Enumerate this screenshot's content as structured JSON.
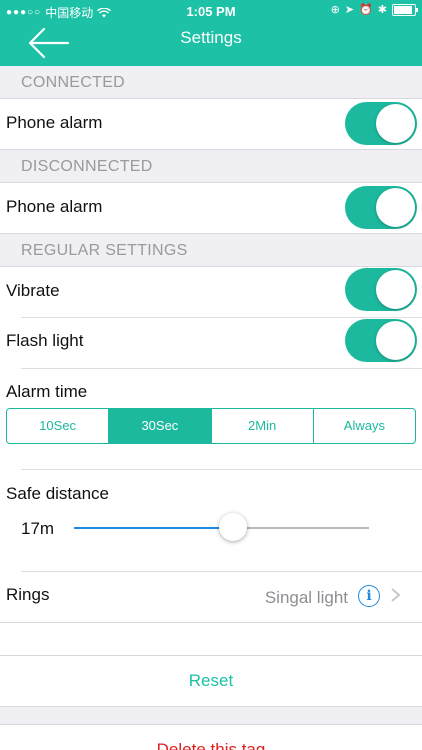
{
  "status_bar": {
    "carrier": "中国移动",
    "time": "1:05 PM"
  },
  "nav": {
    "title": "Settings",
    "back_icon": "back-arrow-icon"
  },
  "sections": {
    "connected": {
      "header": "CONNECTED",
      "phone_alarm_label": "Phone alarm",
      "phone_alarm_on": true
    },
    "disconnected": {
      "header": "DISCONNECTED",
      "phone_alarm_label": "Phone alarm",
      "phone_alarm_on": true
    },
    "regular": {
      "header": "REGULAR SETTINGS",
      "vibrate_label": "Vibrate",
      "vibrate_on": true,
      "flash_label": "Flash light",
      "flash_on": true,
      "alarm_time_label": "Alarm time",
      "alarm_time_options": [
        "10Sec",
        "30Sec",
        "2Min",
        "Always"
      ],
      "alarm_time_selected": "30Sec",
      "safe_distance_label": "Safe distance",
      "safe_distance_value": "17m",
      "safe_distance_slider_fraction": 0.54,
      "rings_label": "Rings",
      "rings_value": "Singal light"
    }
  },
  "actions": {
    "reset_label": "Reset",
    "delete_label": "Delete this tag"
  },
  "colors": {
    "accent": "#1cc1a6",
    "toggle_on": "#1cb99e",
    "link_blue": "#1f8ae0",
    "danger": "#e02020"
  }
}
